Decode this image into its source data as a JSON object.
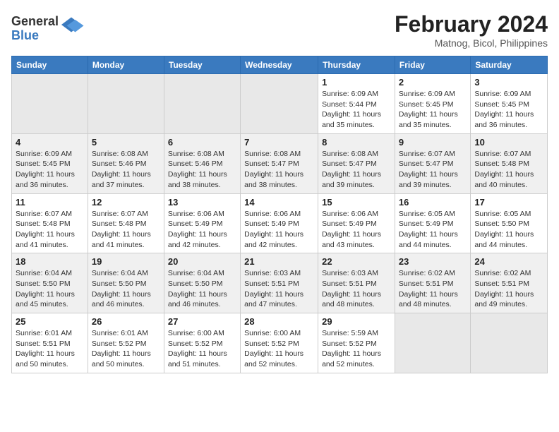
{
  "header": {
    "logo_general": "General",
    "logo_blue": "Blue",
    "month_year": "February 2024",
    "location": "Matnog, Bicol, Philippines"
  },
  "days_of_week": [
    "Sunday",
    "Monday",
    "Tuesday",
    "Wednesday",
    "Thursday",
    "Friday",
    "Saturday"
  ],
  "weeks": [
    [
      {
        "day": "",
        "info": ""
      },
      {
        "day": "",
        "info": ""
      },
      {
        "day": "",
        "info": ""
      },
      {
        "day": "",
        "info": ""
      },
      {
        "day": "1",
        "info": "Sunrise: 6:09 AM\nSunset: 5:44 PM\nDaylight: 11 hours\nand 35 minutes."
      },
      {
        "day": "2",
        "info": "Sunrise: 6:09 AM\nSunset: 5:45 PM\nDaylight: 11 hours\nand 35 minutes."
      },
      {
        "day": "3",
        "info": "Sunrise: 6:09 AM\nSunset: 5:45 PM\nDaylight: 11 hours\nand 36 minutes."
      }
    ],
    [
      {
        "day": "4",
        "info": "Sunrise: 6:09 AM\nSunset: 5:45 PM\nDaylight: 11 hours\nand 36 minutes."
      },
      {
        "day": "5",
        "info": "Sunrise: 6:08 AM\nSunset: 5:46 PM\nDaylight: 11 hours\nand 37 minutes."
      },
      {
        "day": "6",
        "info": "Sunrise: 6:08 AM\nSunset: 5:46 PM\nDaylight: 11 hours\nand 38 minutes."
      },
      {
        "day": "7",
        "info": "Sunrise: 6:08 AM\nSunset: 5:47 PM\nDaylight: 11 hours\nand 38 minutes."
      },
      {
        "day": "8",
        "info": "Sunrise: 6:08 AM\nSunset: 5:47 PM\nDaylight: 11 hours\nand 39 minutes."
      },
      {
        "day": "9",
        "info": "Sunrise: 6:07 AM\nSunset: 5:47 PM\nDaylight: 11 hours\nand 39 minutes."
      },
      {
        "day": "10",
        "info": "Sunrise: 6:07 AM\nSunset: 5:48 PM\nDaylight: 11 hours\nand 40 minutes."
      }
    ],
    [
      {
        "day": "11",
        "info": "Sunrise: 6:07 AM\nSunset: 5:48 PM\nDaylight: 11 hours\nand 41 minutes."
      },
      {
        "day": "12",
        "info": "Sunrise: 6:07 AM\nSunset: 5:48 PM\nDaylight: 11 hours\nand 41 minutes."
      },
      {
        "day": "13",
        "info": "Sunrise: 6:06 AM\nSunset: 5:49 PM\nDaylight: 11 hours\nand 42 minutes."
      },
      {
        "day": "14",
        "info": "Sunrise: 6:06 AM\nSunset: 5:49 PM\nDaylight: 11 hours\nand 42 minutes."
      },
      {
        "day": "15",
        "info": "Sunrise: 6:06 AM\nSunset: 5:49 PM\nDaylight: 11 hours\nand 43 minutes."
      },
      {
        "day": "16",
        "info": "Sunrise: 6:05 AM\nSunset: 5:49 PM\nDaylight: 11 hours\nand 44 minutes."
      },
      {
        "day": "17",
        "info": "Sunrise: 6:05 AM\nSunset: 5:50 PM\nDaylight: 11 hours\nand 44 minutes."
      }
    ],
    [
      {
        "day": "18",
        "info": "Sunrise: 6:04 AM\nSunset: 5:50 PM\nDaylight: 11 hours\nand 45 minutes."
      },
      {
        "day": "19",
        "info": "Sunrise: 6:04 AM\nSunset: 5:50 PM\nDaylight: 11 hours\nand 46 minutes."
      },
      {
        "day": "20",
        "info": "Sunrise: 6:04 AM\nSunset: 5:50 PM\nDaylight: 11 hours\nand 46 minutes."
      },
      {
        "day": "21",
        "info": "Sunrise: 6:03 AM\nSunset: 5:51 PM\nDaylight: 11 hours\nand 47 minutes."
      },
      {
        "day": "22",
        "info": "Sunrise: 6:03 AM\nSunset: 5:51 PM\nDaylight: 11 hours\nand 48 minutes."
      },
      {
        "day": "23",
        "info": "Sunrise: 6:02 AM\nSunset: 5:51 PM\nDaylight: 11 hours\nand 48 minutes."
      },
      {
        "day": "24",
        "info": "Sunrise: 6:02 AM\nSunset: 5:51 PM\nDaylight: 11 hours\nand 49 minutes."
      }
    ],
    [
      {
        "day": "25",
        "info": "Sunrise: 6:01 AM\nSunset: 5:51 PM\nDaylight: 11 hours\nand 50 minutes."
      },
      {
        "day": "26",
        "info": "Sunrise: 6:01 AM\nSunset: 5:52 PM\nDaylight: 11 hours\nand 50 minutes."
      },
      {
        "day": "27",
        "info": "Sunrise: 6:00 AM\nSunset: 5:52 PM\nDaylight: 11 hours\nand 51 minutes."
      },
      {
        "day": "28",
        "info": "Sunrise: 6:00 AM\nSunset: 5:52 PM\nDaylight: 11 hours\nand 52 minutes."
      },
      {
        "day": "29",
        "info": "Sunrise: 5:59 AM\nSunset: 5:52 PM\nDaylight: 11 hours\nand 52 minutes."
      },
      {
        "day": "",
        "info": ""
      },
      {
        "day": "",
        "info": ""
      }
    ]
  ]
}
